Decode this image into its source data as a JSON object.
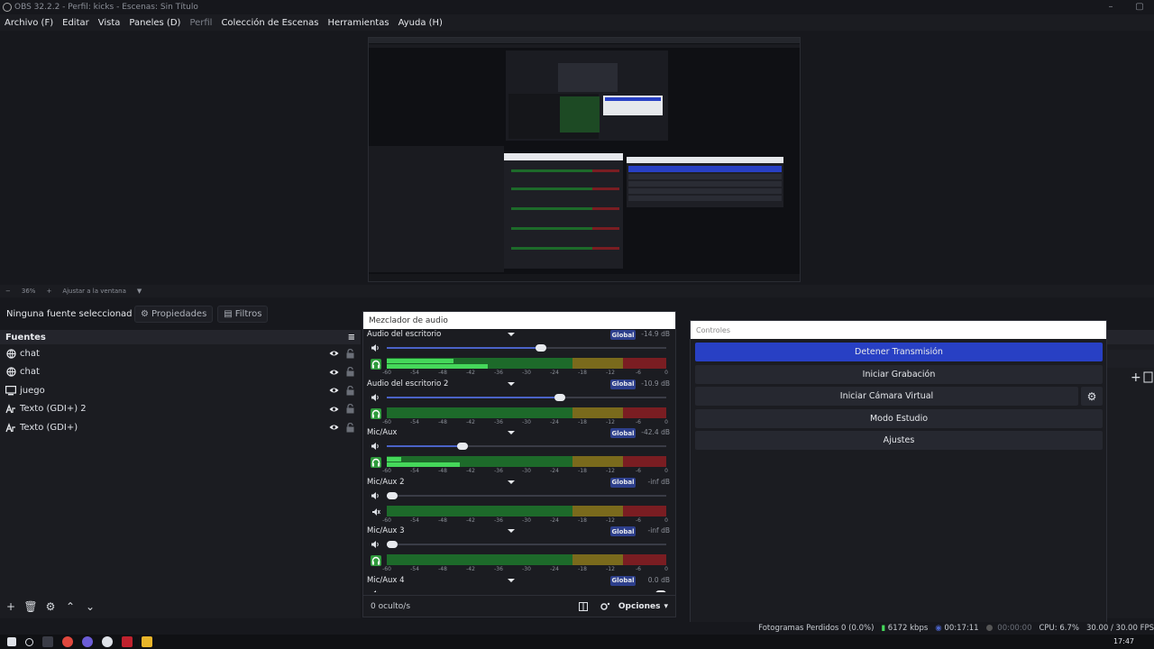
{
  "window": {
    "title": "OBS 32.2.2 - Perfil: kicks - Escenas: Sin Título"
  },
  "menu": [
    {
      "label": "Archivo (F)",
      "dim": false
    },
    {
      "label": "Editar",
      "dim": false
    },
    {
      "label": "Vista",
      "dim": false
    },
    {
      "label": "Paneles (D)",
      "dim": false
    },
    {
      "label": "Perfil",
      "dim": true
    },
    {
      "label": "Colección de Escenas",
      "dim": false
    },
    {
      "label": "Herramientas",
      "dim": false
    },
    {
      "label": "Ayuda (H)",
      "dim": false
    }
  ],
  "preview_bar": {
    "minus": "−",
    "zoom": "36%",
    "plus": "+",
    "fit": "Ajustar a la ventana"
  },
  "source_toolbar": {
    "no_source": "Ninguna fuente seleccionad",
    "properties": "Propiedades",
    "filters": "Filtros"
  },
  "sources": {
    "title": "Fuentes",
    "items": [
      {
        "name": "chat",
        "icon": "globe-icon"
      },
      {
        "name": "chat",
        "icon": "globe-icon"
      },
      {
        "name": "juego",
        "icon": "monitor-icon"
      },
      {
        "name": "Texto (GDI+) 2",
        "icon": "text-icon"
      },
      {
        "name": "Texto (GDI+)",
        "icon": "text-icon"
      }
    ]
  },
  "mixer": {
    "title": "Mezclador de audio",
    "global_label": "Global",
    "channels": [
      {
        "name": "Audio del escritorio",
        "db": "-14.9 dB",
        "volume": 0.55,
        "level_a": 0.24,
        "level_b": 0.36,
        "monitor": "headphones-icon",
        "active": true
      },
      {
        "name": "Audio del escritorio 2",
        "db": "-10.9 dB",
        "volume": 0.62,
        "level_a": 0,
        "level_b": 0,
        "monitor": "headphones-icon",
        "active": true
      },
      {
        "name": "Mic/Aux",
        "db": "-42.4 dB",
        "volume": 0.27,
        "level_a": 0.05,
        "level_b": 0.26,
        "monitor": "headphones-icon",
        "active": true
      },
      {
        "name": "Mic/Aux 2",
        "db": "-inf dB",
        "volume": 0.02,
        "level_a": 0,
        "level_b": 0,
        "monitor": "speaker-muted-icon",
        "active": false
      },
      {
        "name": "Mic/Aux 3",
        "db": "-inf dB",
        "volume": 0.02,
        "level_a": 0,
        "level_b": 0,
        "monitor": "headphones-icon",
        "active": true
      },
      {
        "name": "Mic/Aux 4",
        "db": "0.0 dB",
        "volume": 0.98,
        "level_a": 0,
        "level_b": 0,
        "monitor": "headphones-icon",
        "active": true
      }
    ],
    "scale": [
      "-60",
      "-54",
      "-48",
      "-42",
      "-36",
      "-30",
      "-24",
      "-18",
      "-12",
      "-6",
      "0"
    ],
    "hidden_count": "0 oculto/s",
    "options": "Opciones"
  },
  "controls": {
    "title": "Controles",
    "buttons": [
      {
        "label": "Detener Transmisión",
        "primary": true
      },
      {
        "label": "Iniciar Grabación",
        "primary": false
      },
      {
        "label": "Iniciar Cámara Virtual",
        "primary": false
      },
      {
        "label": "Modo Estudio",
        "primary": false
      },
      {
        "label": "Ajustes",
        "primary": false
      }
    ]
  },
  "status": {
    "dropped": "Fotogramas Perdidos 0 (0.0%)",
    "bitrate": "6172 kbps",
    "stream_time": "00:17:11",
    "rec_time": "00:00:00",
    "cpu": "CPU: 6.7%",
    "fps": "30.00 / 30.00 FPS"
  },
  "taskbar": {
    "clock": "17:47"
  },
  "colors": {
    "accent": "#2840c4",
    "meter_green": "#45d85a",
    "global_badge": "#2d3f8c"
  }
}
